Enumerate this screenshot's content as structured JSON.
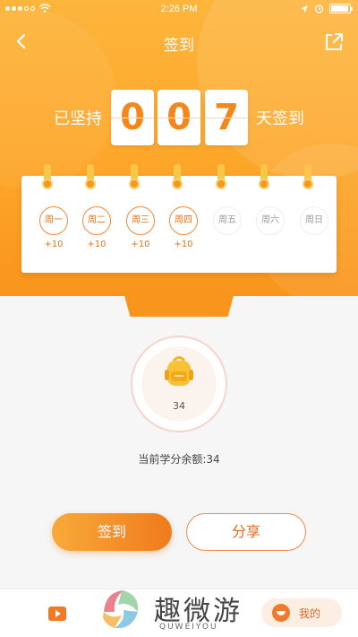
{
  "status_bar": {
    "time": "2:26 PM"
  },
  "nav": {
    "title": "签到"
  },
  "streak": {
    "prefix": "已坚持",
    "digits": [
      "0",
      "0",
      "7"
    ],
    "suffix": "天签到"
  },
  "week": [
    {
      "label": "周一",
      "points": "+10",
      "signed": true
    },
    {
      "label": "周二",
      "points": "+10",
      "signed": true
    },
    {
      "label": "周三",
      "points": "+10",
      "signed": true
    },
    {
      "label": "周四",
      "points": "+10",
      "signed": true
    },
    {
      "label": "周五",
      "points": "",
      "signed": false
    },
    {
      "label": "周六",
      "points": "",
      "signed": false
    },
    {
      "label": "周日",
      "points": "",
      "signed": false
    }
  ],
  "badge": {
    "value": "34"
  },
  "balance": {
    "label": "当前学分余额:34"
  },
  "buttons": {
    "sign_in": "签到",
    "share": "分享"
  },
  "tabbar": {
    "mine_label": "我的"
  },
  "watermark": {
    "text": "趣微游",
    "sub": "QUWEIYOU"
  },
  "colors": {
    "accent": "#f3871c",
    "header_top": "#fdb53c",
    "header_bottom": "#f9951c",
    "signed_ring": "#f08a3a"
  },
  "icons": {
    "back": "chevron-left-icon",
    "share": "share-external-icon",
    "badge": "backpack-icon",
    "tab_video": "video-icon",
    "tab_mine": "user-smile-icon"
  }
}
